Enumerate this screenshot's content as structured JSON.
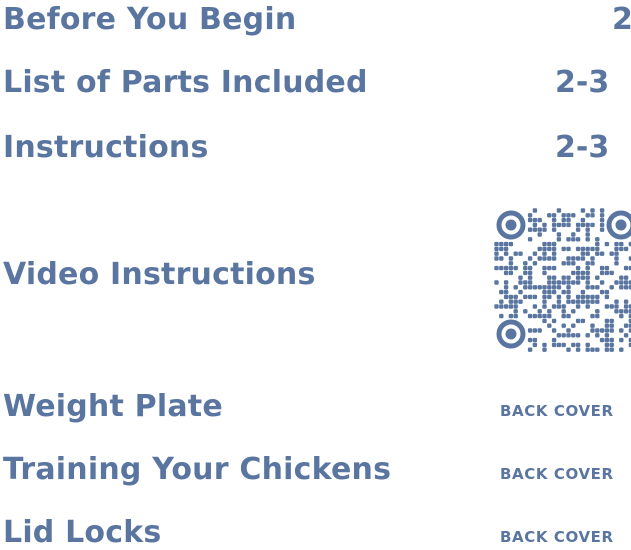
{
  "toc": {
    "entries": [
      {
        "title": "Before You Begin",
        "page": "2"
      },
      {
        "title": "List of Parts Included",
        "page": "2-3"
      },
      {
        "title": "Instructions",
        "page": "2-3"
      },
      {
        "title": "Video Instructions",
        "page": ""
      },
      {
        "title": "Weight Plate",
        "page": "BACK COVER"
      },
      {
        "title": "Training Your Chickens",
        "page": "BACK COVER"
      },
      {
        "title": "Lid Locks",
        "page": "BACK COVER"
      }
    ]
  },
  "qr": {
    "icon": "qr-code-icon",
    "color": "#5a76a0"
  },
  "colors": {
    "text": "#5a76a0",
    "background": "#ffffff"
  }
}
